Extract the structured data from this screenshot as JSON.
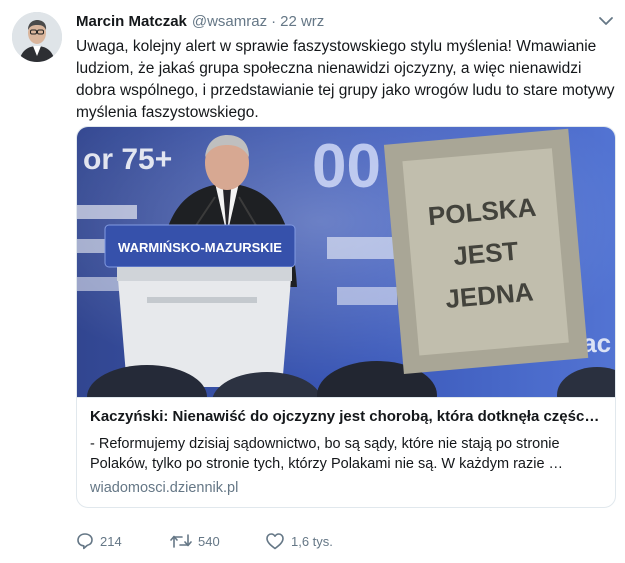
{
  "author": {
    "name": "Marcin Matczak",
    "handle": "@wsamraz",
    "separator": "·",
    "time": "22 wrz",
    "avatar_icon": "user-avatar"
  },
  "tweet": {
    "text": "Uwaga, kolejny alert w sprawie faszystowskiego stylu myślenia! Wmawianie ludziom, że jakaś grupa społeczna nienawidzi ojczyzny, a więc nienawidzi dobra wspólnego, i przedstawianie tej grupy jako wrogów ludu to stare motywy myślenia faszystowskiego."
  },
  "card": {
    "image": {
      "description_icon": "news-photo",
      "backdrop_text_line1": "or 75+",
      "backdrop_text_line2": "00 d",
      "podium_label": "WARMIŃSKO-MAZURSKIE",
      "sign_text": [
        "POLSKA",
        "JEST",
        "JEDNA"
      ]
    },
    "title": "Kaczyński: Nienawiść do ojczyzny jest chorobą, która dotknęła częśc…",
    "description": "- Reformujemy dzisiaj sądownictwo, bo są sądy, które nie stają po stronie Polaków, tylko po stronie tych, którzy Polakami nie są. W każdym razie …",
    "domain": "wiadomosci.dziennik.pl"
  },
  "actions": {
    "reply_count": "214",
    "retweet_count": "540",
    "like_count": "1,6 tys."
  },
  "colors": {
    "text": "#14171a",
    "secondary": "#657786",
    "border": "#e1e8ed"
  }
}
